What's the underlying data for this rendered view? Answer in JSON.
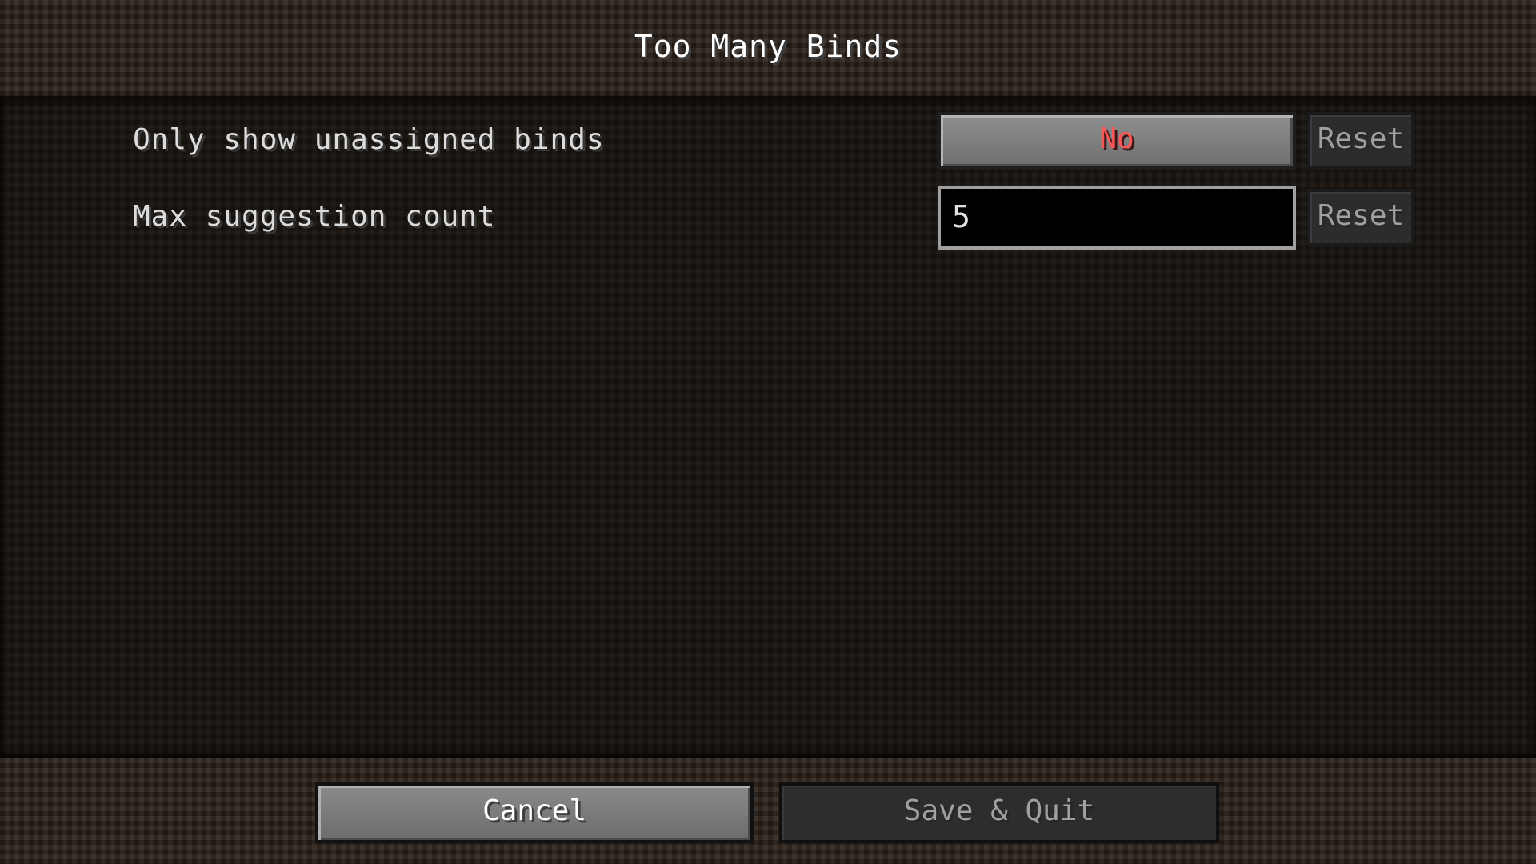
{
  "screen": {
    "title": "Too Many Binds"
  },
  "options": [
    {
      "label": "Only show unassigned binds",
      "control": "toggle",
      "value": "No",
      "value_color": "#ff5555",
      "reset_label": "Reset"
    },
    {
      "label": "Max suggestion count",
      "control": "text-input",
      "value": "5",
      "reset_label": "Reset"
    }
  ],
  "footer": {
    "cancel_label": "Cancel",
    "save_label": "Save & Quit"
  }
}
